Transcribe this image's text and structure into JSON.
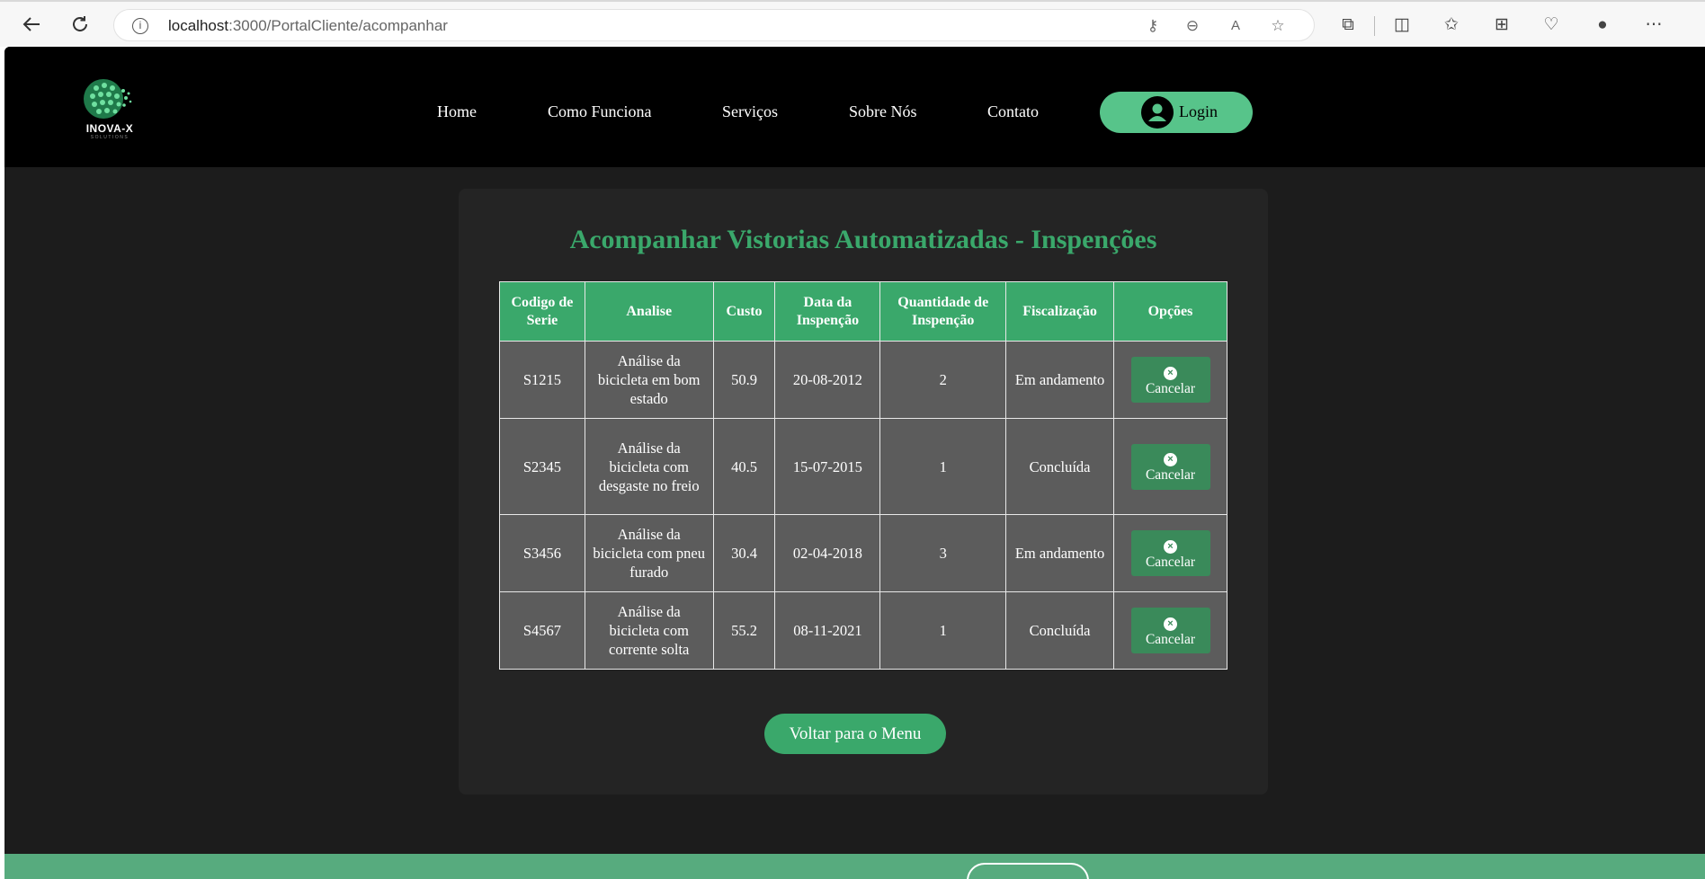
{
  "browser": {
    "url_host": "localhost",
    "url_rest": ":3000/PortalCliente/acompanhar"
  },
  "icons": {
    "back": "arrow-left-icon",
    "reload": "reload-icon",
    "info": "info-icon",
    "key": "key-icon",
    "zoom": "zoom-out-icon",
    "read_aloud": "read-aloud-icon",
    "favorite": "star-icon",
    "extensions": "puzzle-icon",
    "split": "split-screen-icon",
    "favorites": "favorites-icon",
    "collections": "collections-icon",
    "health": "browser-essentials-icon",
    "profile": "profile-icon",
    "more": "more-icon"
  },
  "site": {
    "logo_text": "INOVA-X",
    "logo_sub": "SOLUTIONS",
    "nav": [
      "Home",
      "Como Funciona",
      "Serviços",
      "Sobre Nós",
      "Contato"
    ],
    "login_label": "Login"
  },
  "main": {
    "title": "Acompanhar Vistorias Automatizadas - Inspenções",
    "columns": [
      "Codigo de Serie",
      "Analise",
      "Custo",
      "Data da Inspenção",
      "Quantidade de Inspenção",
      "Fiscalização",
      "Opções"
    ],
    "rows": [
      {
        "code": "S1215",
        "analysis": "Análise da bicicleta em bom estado",
        "cost": "50.9",
        "date": "20-08-2012",
        "qty": "2",
        "status": "Em andamento",
        "action": "Cancelar"
      },
      {
        "code": "S2345",
        "analysis": "Análise da bicicleta com desgaste no freio",
        "cost": "40.5",
        "date": "15-07-2015",
        "qty": "1",
        "status": "Concluída",
        "action": "Cancelar"
      },
      {
        "code": "S3456",
        "analysis": "Análise da bicicleta com pneu furado",
        "cost": "30.4",
        "date": "02-04-2018",
        "qty": "3",
        "status": "Em andamento",
        "action": "Cancelar"
      },
      {
        "code": "S4567",
        "analysis": "Análise da bicicleta com corrente solta",
        "cost": "55.2",
        "date": "08-11-2021",
        "qty": "1",
        "status": "Concluída",
        "action": "Cancelar"
      }
    ],
    "back_button": "Voltar para o Menu"
  },
  "colors": {
    "accent": "#3aa86b",
    "login": "#57c48a",
    "cell_bg": "#5c5c5c",
    "page_bg": "#1c1c1c",
    "header_bg": "#000000"
  }
}
